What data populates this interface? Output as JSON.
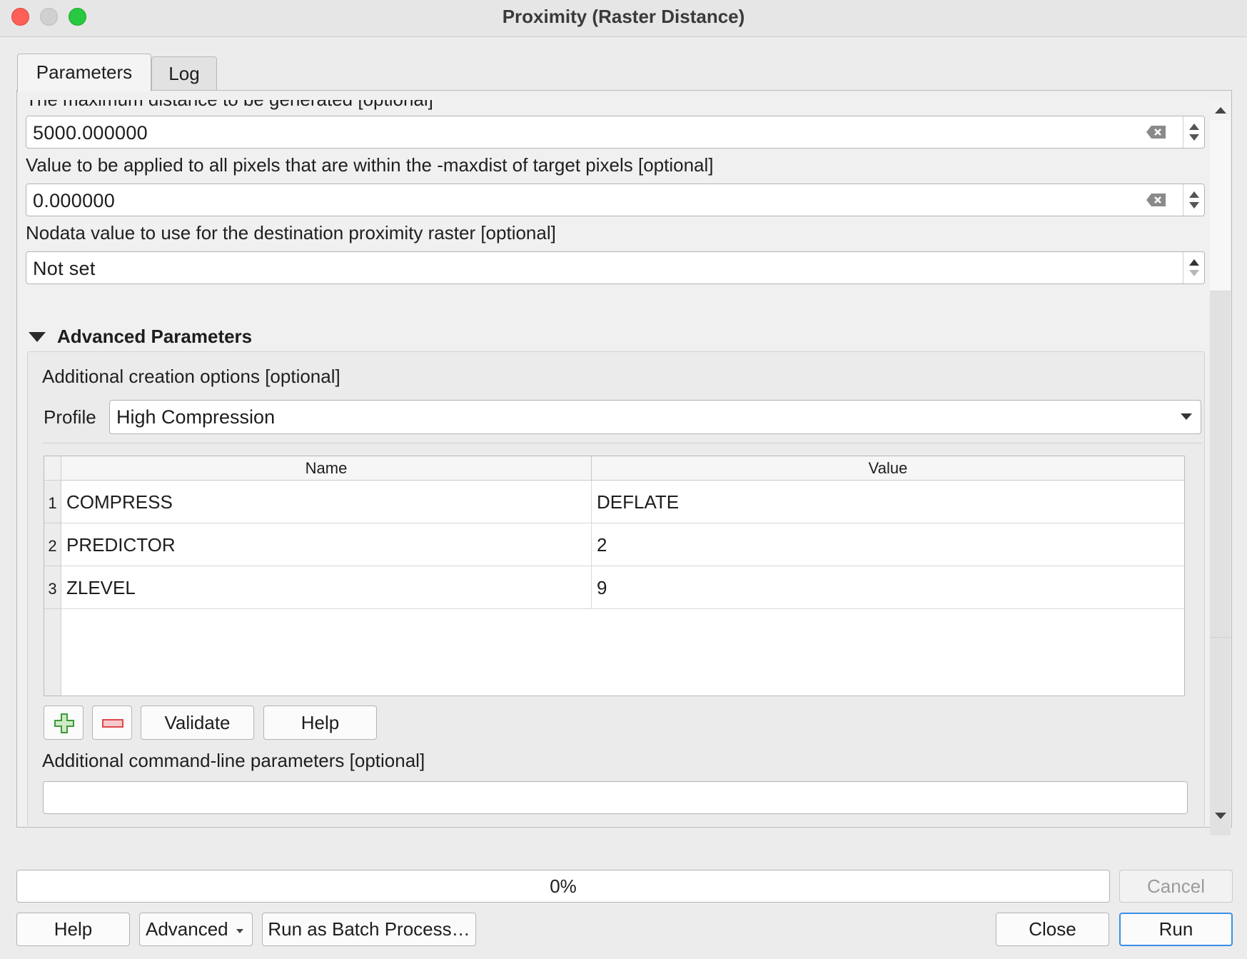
{
  "window": {
    "title": "Proximity (Raster Distance)"
  },
  "tabs": [
    {
      "label": "Parameters",
      "active": true
    },
    {
      "label": "Log",
      "active": false
    }
  ],
  "params": {
    "maxdist": {
      "label": "The maximum distance to be generated [optional]",
      "value": "5000.000000"
    },
    "fixed_buf": {
      "label": "Value to be applied to all pixels that are within the -maxdist of target pixels [optional]",
      "value": "0.000000"
    },
    "nodata": {
      "label": "Nodata value to use for the destination proximity raster [optional]",
      "value": "Not set"
    }
  },
  "advanced": {
    "header": "Advanced Parameters",
    "creation_options_label": "Additional creation options [optional]",
    "profile_label": "Profile",
    "profile_value": "High Compression",
    "table": {
      "columns": [
        "Name",
        "Value"
      ],
      "rows": [
        {
          "index": "1",
          "name": "COMPRESS",
          "value": "DEFLATE"
        },
        {
          "index": "2",
          "name": "PREDICTOR",
          "value": "2"
        },
        {
          "index": "3",
          "name": "ZLEVEL",
          "value": "9"
        }
      ]
    },
    "validate_label": "Validate",
    "help_label": "Help",
    "cmdline_label": "Additional command-line parameters [optional]",
    "cmdline_value": ""
  },
  "progress": {
    "text": "0%",
    "percent": 0
  },
  "footer": {
    "cancel": "Cancel",
    "help": "Help",
    "advanced": "Advanced",
    "batch": "Run as Batch Process…",
    "close": "Close",
    "run": "Run"
  },
  "colors": {
    "accent": "#3c8fe6",
    "close_light": "#fe5f57",
    "max_light": "#28c840",
    "add_icon": "#3a9b3a",
    "remove_icon": "#e0474c"
  }
}
